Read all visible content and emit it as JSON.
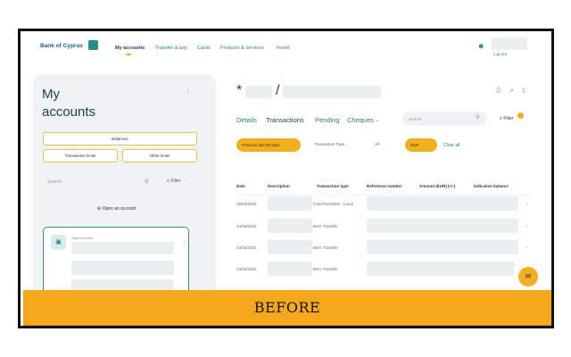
{
  "header": {
    "logo": "Bank of Cyprus",
    "nav": [
      "My accounts",
      "Transfer & pay",
      "Cards",
      "Products & services",
      "Invest"
    ],
    "logout": "Log out"
  },
  "sidebar": {
    "title_line1": "My",
    "title_line2": "accounts",
    "balances": "Balances",
    "transaction_limits": "Transaction limits",
    "other_limits": "Other limits",
    "search_placeholder": "Search",
    "filter": "Filter",
    "open_account": "Open an account",
    "card_label": "Sight Account"
  },
  "account": {
    "star": "*",
    "slash": "/"
  },
  "tabs": [
    "Details",
    "Transactions",
    "Pending",
    "Cheques"
  ],
  "toolbar": {
    "search_placeholder": "Search",
    "filter": "Filter",
    "period_pill": "Previous last 90 days",
    "transaction_type": "Transaction Type",
    "all": "All",
    "eur_pill": "EUR",
    "clear_all": "Clear all"
  },
  "table": {
    "headers": [
      "Date",
      "Description",
      "Transaction type",
      "Reference number",
      "Amount (EUR) (+/-)",
      "Indicative balance"
    ],
    "rows": [
      {
        "date": "15/04/2022",
        "type": "Card Purchase - Local"
      },
      {
        "date": "14/04/2022",
        "type": "BOC Transfer"
      },
      {
        "date": "14/04/2022",
        "type": "BOC Transfer"
      },
      {
        "date": "14/04/2022",
        "type": "BOC Transfer"
      }
    ]
  },
  "banner": {
    "text": "BEFORE"
  },
  "colors": {
    "accent": "#f2b01e",
    "brand_teal": "#2a7f7f",
    "navy": "#1b3d5c",
    "banner": "#f5a81c"
  },
  "icons": [
    "bank-logo-icon",
    "user-icon",
    "kebab-icon",
    "search-icon",
    "filter-icon",
    "plus-circle-icon",
    "account-card-icon",
    "chevron-down-icon",
    "print-icon",
    "share-icon",
    "download-icon",
    "chat-fab-icon"
  ]
}
